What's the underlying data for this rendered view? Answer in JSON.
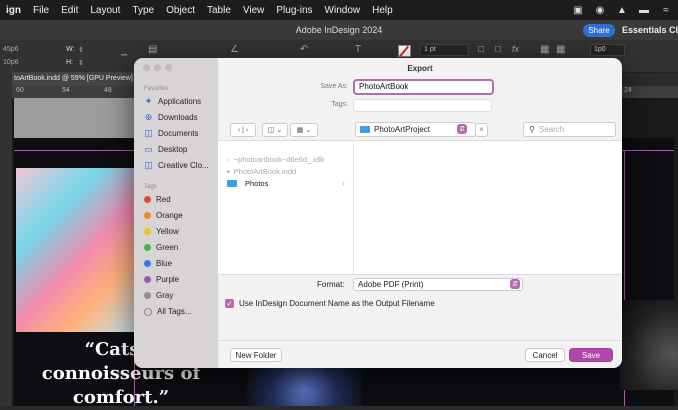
{
  "menubar": {
    "items": [
      "ign",
      "File",
      "Edit",
      "Layout",
      "Type",
      "Object",
      "Table",
      "View",
      "Plug-ins",
      "Window",
      "Help"
    ]
  },
  "app": {
    "title": "Adobe InDesign 2024",
    "share": "Share",
    "workspace": "Essentials Cl"
  },
  "control": {
    "w_label": "W:",
    "h_label": "H:",
    "stroke": "1 pt",
    "value_1p0": "1p0",
    "left_val_1": "45p6",
    "left_val_2": "10p6"
  },
  "doc": {
    "tab": "toArtBook.indd @ 59% [GPU Preview]",
    "ruler": [
      "60",
      "54",
      "48",
      "24"
    ]
  },
  "canvas": {
    "caption": "“Cats a connoisseurs of comfort.”"
  },
  "dialog": {
    "title": "Export",
    "save_as_label": "Save As:",
    "save_as_value": "PhotoArtBook",
    "tags_label": "Tags:",
    "location": "PhotoArtProject",
    "search_placeholder": "Search",
    "favorites_header": "Favorites",
    "favorites": [
      "Applications",
      "Downloads",
      "Documents",
      "Desktop",
      "Creative Clo..."
    ],
    "tags_header": "Tags",
    "tags": [
      {
        "label": "Red",
        "color": "#e0463c"
      },
      {
        "label": "Orange",
        "color": "#f08a24"
      },
      {
        "label": "Yellow",
        "color": "#e7c52a"
      },
      {
        "label": "Green",
        "color": "#3fb54a"
      },
      {
        "label": "Blue",
        "color": "#3478f6"
      },
      {
        "label": "Purple",
        "color": "#9b59b6"
      },
      {
        "label": "Gray",
        "color": "#8e8e93"
      },
      {
        "label": "All Tags...",
        "color": ""
      }
    ],
    "files": [
      "~photoartbook~d6e6d_.idlk",
      "PhotoArtBook.indd",
      "Photos"
    ],
    "format_label": "Format:",
    "format_value": "Adobe PDF (Print)",
    "checkbox_label": "Use InDesign Document Name as the Output Filename",
    "new_folder": "New Folder",
    "cancel": "Cancel",
    "save": "Save"
  },
  "colors": {
    "accent": "#b046a8",
    "folder": "#3aa0e8"
  }
}
